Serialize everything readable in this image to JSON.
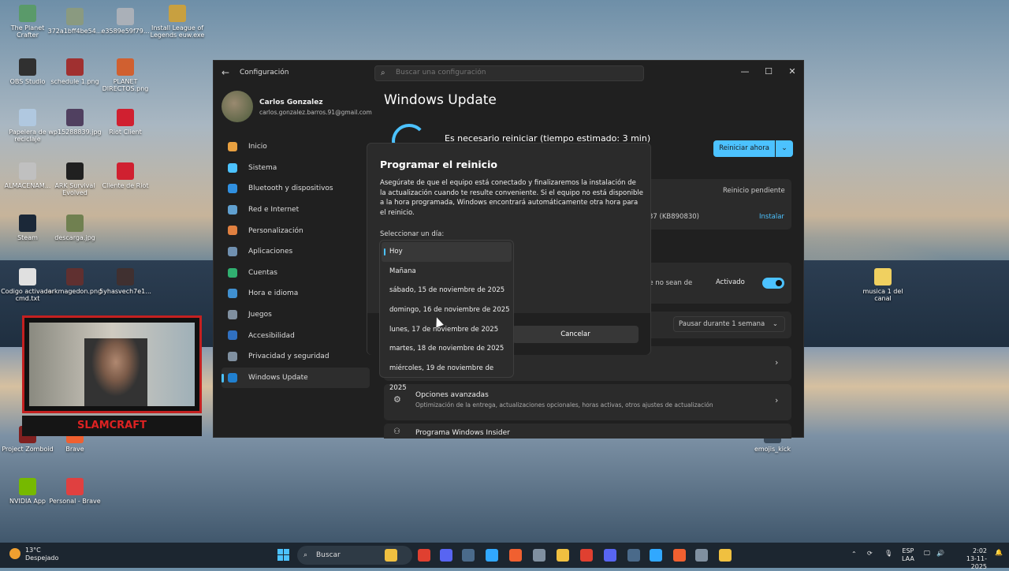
{
  "desktop": {
    "icons": [
      {
        "label": "The Planet Crafter",
        "color": "#5a9a6a"
      },
      {
        "label": "372a1bff4be54...",
        "color": "#8a9a80"
      },
      {
        "label": "e3589e59f79...",
        "color": "#aab0b8"
      },
      {
        "label": "Install League of Legends euw.exe",
        "color": "#c8a040"
      },
      {
        "label": "OBS Studio",
        "color": "#303030"
      },
      {
        "label": "schedule 1.png",
        "color": "#a03030"
      },
      {
        "label": "PLANET DIRECTOS.png",
        "color": "#d06030"
      },
      {
        "label": "Papelera de reciclaje",
        "color": "#b0c8e0"
      },
      {
        "label": "wp15288839.jpg",
        "color": "#504060"
      },
      {
        "label": "Riot Client",
        "color": "#d02030"
      },
      {
        "label": "ALMACENAM...",
        "color": "#c0c0c0"
      },
      {
        "label": "ARK Survival Evolved",
        "color": "#202020"
      },
      {
        "label": "Cliente de Riot",
        "color": "#d02030"
      },
      {
        "label": "Steam",
        "color": "#1b2838"
      },
      {
        "label": "descarga.jpg",
        "color": "#708050"
      },
      {
        "label": "Codigo activador cmd.txt",
        "color": "#e0e0e0"
      },
      {
        "label": "arkmagedon.png",
        "color": "#603030"
      },
      {
        "label": "5yhasvech7e1...",
        "color": "#403030"
      },
      {
        "label": "musica 1 del canal",
        "color": "#f0d060"
      },
      {
        "label": "Project Zomboid",
        "color": "#802020"
      },
      {
        "label": "Brave",
        "color": "#f06030"
      },
      {
        "label": "NVIDIA App",
        "color": "#76b900"
      },
      {
        "label": "Personal - Brave",
        "color": "#e04040"
      },
      {
        "label": "emojis_kick",
        "color": "#3a4a5a"
      }
    ]
  },
  "settings": {
    "app_title": "Configuración",
    "search_placeholder": "Buscar una configuración",
    "window_controls": {
      "minimize": "—",
      "maximize": "☐",
      "close": "✕"
    },
    "user": {
      "name": "Carlos Gonzalez",
      "email": "carlos.gonzalez.barros.91@gmail.com"
    },
    "nav": [
      {
        "label": "Inicio",
        "color": "#e8a040"
      },
      {
        "label": "Sistema",
        "color": "#4cc2ff"
      },
      {
        "label": "Bluetooth y dispositivos",
        "color": "#3090e0"
      },
      {
        "label": "Red e Internet",
        "color": "#60a0d0"
      },
      {
        "label": "Personalización",
        "color": "#e08040"
      },
      {
        "label": "Aplicaciones",
        "color": "#7090b0"
      },
      {
        "label": "Cuentas",
        "color": "#30b070"
      },
      {
        "label": "Hora e idioma",
        "color": "#4090d0"
      },
      {
        "label": "Juegos",
        "color": "#8090a0"
      },
      {
        "label": "Accesibilidad",
        "color": "#3070c0"
      },
      {
        "label": "Privacidad y seguridad",
        "color": "#8090a0"
      },
      {
        "label": "Windows Update",
        "color": "#2080d0"
      }
    ],
    "page_title": "Windows Update",
    "update_status": "Es necesario reiniciar (tiempo estimado: 3 min)",
    "restart_now": "Reiniciar ahora",
    "pending_label": "Reinicio pendiente",
    "kb_fragment": "37 (KB890830)",
    "install_link": "Instalar",
    "latest_fragment": "ue no sean de",
    "activated_label": "Activado",
    "pause_option": "Pausar durante 1 semana",
    "advanced": {
      "title": "Opciones avanzadas",
      "desc": "Optimización de la entrega, actualizaciones opcionales, horas activas, otros ajustes de actualización"
    },
    "insider": {
      "title": "Programa Windows Insider"
    }
  },
  "dialog": {
    "title": "Programar el reinicio",
    "body": "Asegúrate de que el equipo está conectado y finalizaremos la instalación de la actualización cuando te resulte conveniente. Si el equipo no está disponible a la hora programada, Windows encontrará automáticamente otra hora para el reinicio.",
    "select_label": "Seleccionar un día:",
    "options": [
      "Hoy",
      "Mañana",
      "sábado, 15 de noviembre de 2025",
      "domingo, 16 de noviembre de 2025",
      "lunes, 17 de noviembre de 2025",
      "martes, 18 de noviembre de 2025",
      "miércoles, 19 de noviembre de 2025"
    ],
    "selected_option": "Hoy",
    "cancel": "Cancelar"
  },
  "webcam": {
    "label": "SLAMCRAFT"
  },
  "taskbar": {
    "weather_temp": "13°C",
    "weather_desc": "Despejado",
    "search": "Buscar",
    "lang_top": "ESP",
    "lang_bottom": "LAA",
    "time": "2:02",
    "date": "13-11-2025",
    "apps": [
      {
        "name": "file-explorer-icon",
        "color": "#f0c040"
      },
      {
        "name": "chrome-icon",
        "color": "#e04030"
      },
      {
        "name": "discord-icon",
        "color": "#5865f2"
      },
      {
        "name": "steam-icon",
        "color": "#4a6a8a"
      },
      {
        "name": "photoshop-icon",
        "color": "#31a8ff"
      },
      {
        "name": "brave-icon",
        "color": "#f06030"
      },
      {
        "name": "settings-icon",
        "color": "#8090a0"
      }
    ]
  }
}
